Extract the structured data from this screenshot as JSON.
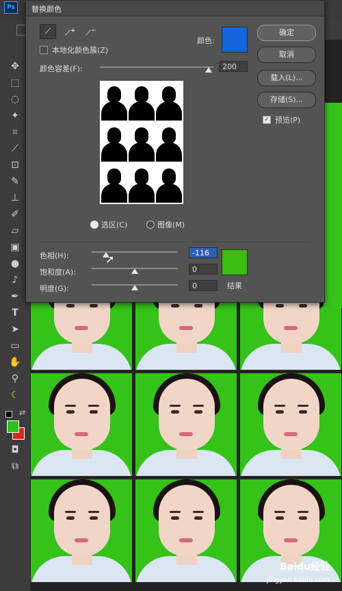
{
  "app": {
    "logo": "Ps"
  },
  "dialog": {
    "title": "替换颜色",
    "close": "✕",
    "color_label": "颜色:",
    "color_swatch": "#1565dc",
    "localized_label": "本地化颜色簇(Z)",
    "tolerance_label": "颜色容差(F):",
    "tolerance_value": "200",
    "radio_selection": "选区(C)",
    "radio_image": "图像(M)",
    "hue_label": "色相(H):",
    "hue_value": "-116",
    "saturation_label": "饱和度(A):",
    "saturation_value": "0",
    "lightness_label": "明度(G):",
    "lightness_value": "0",
    "result_label": "结果",
    "result_swatch": "#3bbd12",
    "buttons": {
      "ok": "确定",
      "cancel": "取消",
      "load": "载入(L)...",
      "save": "存储(S)..."
    },
    "preview_label": "预览(P)"
  },
  "tools": [
    "move-icon",
    "marquee-icon",
    "lasso-icon",
    "magic-wand-icon",
    "crop-icon",
    "eyedropper-icon",
    "frame-icon",
    "brush-icon",
    "stamp-icon",
    "history-brush-icon",
    "eraser-icon",
    "gradient-icon",
    "blur-icon",
    "dodge-icon",
    "pen-icon",
    "type-icon",
    "path-select-icon",
    "shape-icon",
    "hand-icon",
    "zoom-icon",
    "banana-icon"
  ],
  "colors": {
    "foreground": "#2fbf1a",
    "background": "#e0241c",
    "photo_bg": "#35c219"
  },
  "watermark": {
    "brand": "Baidu经验",
    "url": "jingyan.baidu.com"
  }
}
